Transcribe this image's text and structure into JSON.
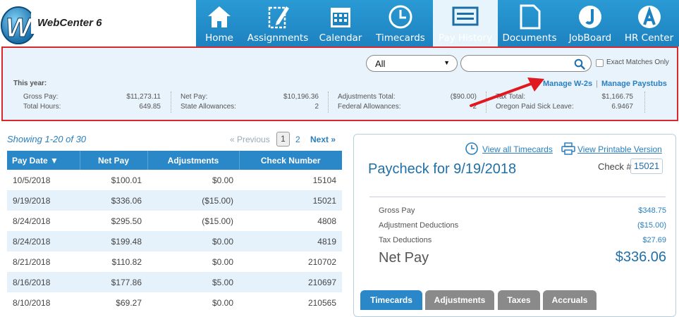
{
  "logo": {
    "text": "WebCenter 6"
  },
  "nav": [
    {
      "label": "Home",
      "icon": "home-icon"
    },
    {
      "label": "Assignments",
      "icon": "pencil-doc-icon"
    },
    {
      "label": "Calendar",
      "icon": "calendar-icon"
    },
    {
      "label": "Timecards",
      "icon": "clock-icon"
    },
    {
      "label": "Pay History",
      "icon": "paycheck-icon",
      "active": true
    },
    {
      "label": "Documents",
      "icon": "document-icon"
    },
    {
      "label": "JobBoard",
      "icon": "jobboard-icon"
    },
    {
      "label": "HR Center",
      "icon": "hr-center-icon"
    }
  ],
  "filter": {
    "select_value": "All",
    "search_placeholder": "",
    "exact_label": "Exact Matches Only",
    "this_year_label": "This year:",
    "manage_w2": "Manage W-2s",
    "separator": "|",
    "manage_paystubs": "Manage Paystubs",
    "stats": [
      {
        "label": "Gross Pay:",
        "value": "$11,273.11"
      },
      {
        "label": "Total Hours:",
        "value": "649.85"
      },
      {
        "label": "Net Pay:",
        "value": "$10,196.36"
      },
      {
        "label": "State Allowances:",
        "value": "2"
      },
      {
        "label": "Adjustments Total:",
        "value": "($90.00)"
      },
      {
        "label": "Federal Allowances:",
        "value": "2"
      },
      {
        "label": "Tax Total:",
        "value": "$1,166.75"
      },
      {
        "label": "Oregon Paid Sick Leave:",
        "value": "6.9467"
      }
    ]
  },
  "list": {
    "showing": "Showing 1-20 of 30",
    "prev": "« Previous",
    "pages": [
      "1",
      "2"
    ],
    "next": "Next »",
    "headers": [
      "Pay Date ▼",
      "Net Pay",
      "Adjustments",
      "Check Number"
    ],
    "rows": [
      [
        "10/5/2018",
        "$100.01",
        "$0.00",
        "15104"
      ],
      [
        "9/19/2018",
        "$336.06",
        "($15.00)",
        "15021"
      ],
      [
        "8/24/2018",
        "$295.50",
        "($15.00)",
        "4808"
      ],
      [
        "8/24/2018",
        "$199.48",
        "$0.00",
        "4819"
      ],
      [
        "8/21/2018",
        "$110.82",
        "$0.00",
        "210702"
      ],
      [
        "8/16/2018",
        "$177.86",
        "$5.00",
        "210697"
      ],
      [
        "8/10/2018",
        "$69.27",
        "$0.00",
        "210565"
      ]
    ]
  },
  "detail": {
    "view_timecards": "View all Timecards",
    "view_printable": "View Printable Version",
    "title": "Paycheck for 9/19/2018",
    "check_label": "Check #",
    "check_number": "15021",
    "lines": [
      {
        "label": "Gross Pay",
        "value": "$348.75"
      },
      {
        "label": "Adjustment Deductions",
        "value": "($15.00)"
      },
      {
        "label": "Tax Deductions",
        "value": "$27.69"
      }
    ],
    "net_label": "Net Pay",
    "net_value": "$336.06",
    "tabs": [
      "Timecards",
      "Adjustments",
      "Taxes",
      "Accruals"
    ]
  },
  "colors": {
    "nav": "#2a9ad4",
    "accent": "#2a87c8",
    "highlight": "#d9272e"
  }
}
